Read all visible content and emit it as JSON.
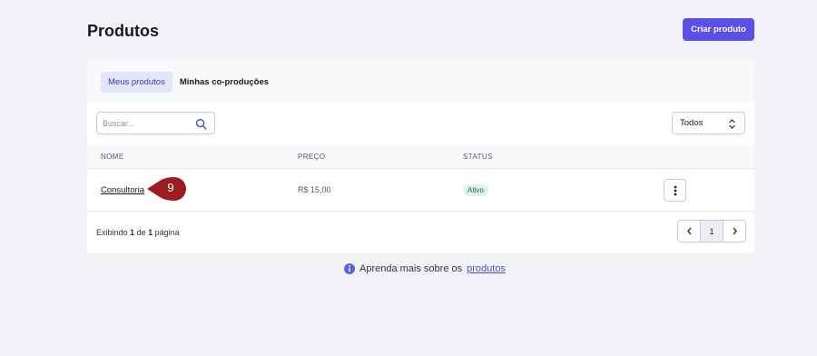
{
  "header": {
    "title": "Produtos",
    "create_button_label": "Criar produto"
  },
  "tabs": [
    {
      "label": "Meus produtos",
      "active": true
    },
    {
      "label": "Minhas co-produções",
      "active": false
    }
  ],
  "search": {
    "placeholder": "Buscar...",
    "value": ""
  },
  "filter": {
    "selected": "Todos"
  },
  "table": {
    "columns": [
      "NOME",
      "PREÇO",
      "STATUS"
    ],
    "rows": [
      {
        "name": "Consultoria",
        "price": "R$ 15,00",
        "status": "Ativo",
        "step_marker": "9"
      }
    ]
  },
  "pagination": {
    "prefix": "Exibindo",
    "current": "1",
    "middle": "de",
    "total": "1",
    "suffix": "página",
    "page_button": "1"
  },
  "help": {
    "text": "Aprenda mais sobre os",
    "link": "produtos"
  },
  "colors": {
    "primary": "#5a4fe6",
    "status_active_bg": "#e0f3ea",
    "marker": "#9b1c22"
  },
  "icons": [
    "search-icon",
    "up-down-icon",
    "vertical-dots-icon",
    "chevron-left-icon",
    "chevron-right-icon",
    "info-icon"
  ]
}
